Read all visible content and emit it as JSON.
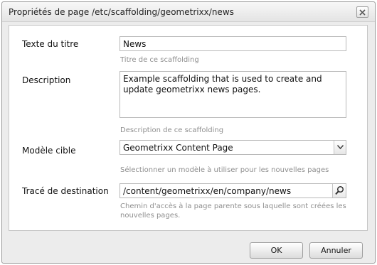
{
  "dialog": {
    "title": "Propriétés de page /etc/scaffolding/geometrixx/news",
    "close_icon": "close-icon"
  },
  "form": {
    "title_field": {
      "label": "Texte du titre",
      "value": "News",
      "hint": "Titre de ce scaffolding"
    },
    "description_field": {
      "label": "Description",
      "value": "Example scaffolding that is used to create and update geometrixx news pages.",
      "hint": "Description de ce scaffolding"
    },
    "template_field": {
      "label": "Modèle cible",
      "value": "Geometrixx Content Page",
      "hint": "Sélectionner un modèle à utiliser pour les nouvelles pages",
      "icon": "chevron-down-icon"
    },
    "destination_field": {
      "label": "Tracé de destination",
      "value": "/content/geometrixx/en/company/news",
      "hint": "Chemin d'accès à la page parente sous laquelle sont créées les nouvelles pages.",
      "icon": "search-icon"
    }
  },
  "buttons": {
    "ok_label": "OK",
    "cancel_label": "Annuler"
  }
}
